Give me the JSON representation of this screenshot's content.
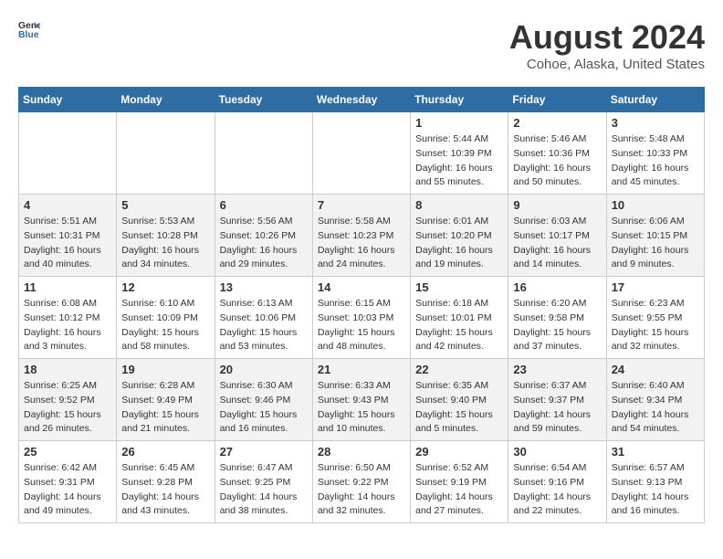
{
  "header": {
    "logo_general": "General",
    "logo_blue": "Blue",
    "month_year": "August 2024",
    "location": "Cohoe, Alaska, United States"
  },
  "calendar": {
    "days_of_week": [
      "Sunday",
      "Monday",
      "Tuesday",
      "Wednesday",
      "Thursday",
      "Friday",
      "Saturday"
    ],
    "weeks": [
      [
        {
          "day": "",
          "info": ""
        },
        {
          "day": "",
          "info": ""
        },
        {
          "day": "",
          "info": ""
        },
        {
          "day": "",
          "info": ""
        },
        {
          "day": "1",
          "info": "Sunrise: 5:44 AM\nSunset: 10:39 PM\nDaylight: 16 hours\nand 55 minutes."
        },
        {
          "day": "2",
          "info": "Sunrise: 5:46 AM\nSunset: 10:36 PM\nDaylight: 16 hours\nand 50 minutes."
        },
        {
          "day": "3",
          "info": "Sunrise: 5:48 AM\nSunset: 10:33 PM\nDaylight: 16 hours\nand 45 minutes."
        }
      ],
      [
        {
          "day": "4",
          "info": "Sunrise: 5:51 AM\nSunset: 10:31 PM\nDaylight: 16 hours\nand 40 minutes."
        },
        {
          "day": "5",
          "info": "Sunrise: 5:53 AM\nSunset: 10:28 PM\nDaylight: 16 hours\nand 34 minutes."
        },
        {
          "day": "6",
          "info": "Sunrise: 5:56 AM\nSunset: 10:26 PM\nDaylight: 16 hours\nand 29 minutes."
        },
        {
          "day": "7",
          "info": "Sunrise: 5:58 AM\nSunset: 10:23 PM\nDaylight: 16 hours\nand 24 minutes."
        },
        {
          "day": "8",
          "info": "Sunrise: 6:01 AM\nSunset: 10:20 PM\nDaylight: 16 hours\nand 19 minutes."
        },
        {
          "day": "9",
          "info": "Sunrise: 6:03 AM\nSunset: 10:17 PM\nDaylight: 16 hours\nand 14 minutes."
        },
        {
          "day": "10",
          "info": "Sunrise: 6:06 AM\nSunset: 10:15 PM\nDaylight: 16 hours\nand 9 minutes."
        }
      ],
      [
        {
          "day": "11",
          "info": "Sunrise: 6:08 AM\nSunset: 10:12 PM\nDaylight: 16 hours\nand 3 minutes."
        },
        {
          "day": "12",
          "info": "Sunrise: 6:10 AM\nSunset: 10:09 PM\nDaylight: 15 hours\nand 58 minutes."
        },
        {
          "day": "13",
          "info": "Sunrise: 6:13 AM\nSunset: 10:06 PM\nDaylight: 15 hours\nand 53 minutes."
        },
        {
          "day": "14",
          "info": "Sunrise: 6:15 AM\nSunset: 10:03 PM\nDaylight: 15 hours\nand 48 minutes."
        },
        {
          "day": "15",
          "info": "Sunrise: 6:18 AM\nSunset: 10:01 PM\nDaylight: 15 hours\nand 42 minutes."
        },
        {
          "day": "16",
          "info": "Sunrise: 6:20 AM\nSunset: 9:58 PM\nDaylight: 15 hours\nand 37 minutes."
        },
        {
          "day": "17",
          "info": "Sunrise: 6:23 AM\nSunset: 9:55 PM\nDaylight: 15 hours\nand 32 minutes."
        }
      ],
      [
        {
          "day": "18",
          "info": "Sunrise: 6:25 AM\nSunset: 9:52 PM\nDaylight: 15 hours\nand 26 minutes."
        },
        {
          "day": "19",
          "info": "Sunrise: 6:28 AM\nSunset: 9:49 PM\nDaylight: 15 hours\nand 21 minutes."
        },
        {
          "day": "20",
          "info": "Sunrise: 6:30 AM\nSunset: 9:46 PM\nDaylight: 15 hours\nand 16 minutes."
        },
        {
          "day": "21",
          "info": "Sunrise: 6:33 AM\nSunset: 9:43 PM\nDaylight: 15 hours\nand 10 minutes."
        },
        {
          "day": "22",
          "info": "Sunrise: 6:35 AM\nSunset: 9:40 PM\nDaylight: 15 hours\nand 5 minutes."
        },
        {
          "day": "23",
          "info": "Sunrise: 6:37 AM\nSunset: 9:37 PM\nDaylight: 14 hours\nand 59 minutes."
        },
        {
          "day": "24",
          "info": "Sunrise: 6:40 AM\nSunset: 9:34 PM\nDaylight: 14 hours\nand 54 minutes."
        }
      ],
      [
        {
          "day": "25",
          "info": "Sunrise: 6:42 AM\nSunset: 9:31 PM\nDaylight: 14 hours\nand 49 minutes."
        },
        {
          "day": "26",
          "info": "Sunrise: 6:45 AM\nSunset: 9:28 PM\nDaylight: 14 hours\nand 43 minutes."
        },
        {
          "day": "27",
          "info": "Sunrise: 6:47 AM\nSunset: 9:25 PM\nDaylight: 14 hours\nand 38 minutes."
        },
        {
          "day": "28",
          "info": "Sunrise: 6:50 AM\nSunset: 9:22 PM\nDaylight: 14 hours\nand 32 minutes."
        },
        {
          "day": "29",
          "info": "Sunrise: 6:52 AM\nSunset: 9:19 PM\nDaylight: 14 hours\nand 27 minutes."
        },
        {
          "day": "30",
          "info": "Sunrise: 6:54 AM\nSunset: 9:16 PM\nDaylight: 14 hours\nand 22 minutes."
        },
        {
          "day": "31",
          "info": "Sunrise: 6:57 AM\nSunset: 9:13 PM\nDaylight: 14 hours\nand 16 minutes."
        }
      ]
    ]
  }
}
